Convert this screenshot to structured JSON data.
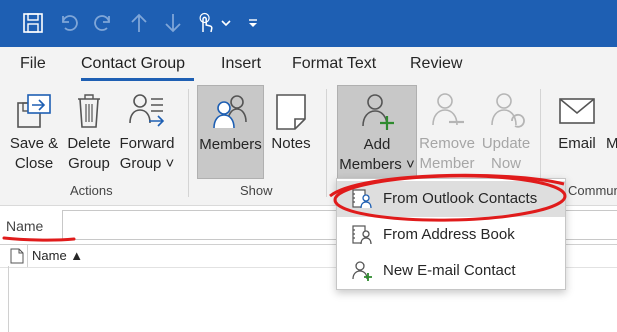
{
  "quick_access": {
    "icons": [
      "save-icon",
      "undo-icon",
      "redo-icon",
      "up-arrow-icon",
      "down-arrow-icon",
      "touch-mode-icon",
      "chevron-down-icon",
      "customize-qat-icon"
    ]
  },
  "tabs": [
    {
      "label": "File",
      "active": false
    },
    {
      "label": "Contact Group",
      "active": true
    },
    {
      "label": "Insert",
      "active": false
    },
    {
      "label": "Format Text",
      "active": false
    },
    {
      "label": "Review",
      "active": false
    }
  ],
  "ribbon": {
    "actions": {
      "group_label": "Actions",
      "save_close": {
        "line1": "Save &",
        "line2": "Close"
      },
      "delete_group": {
        "line1": "Delete",
        "line2": "Group"
      },
      "forward_group": {
        "line1": "Forward",
        "line2": "Group ˅"
      }
    },
    "show": {
      "group_label": "Show",
      "members": {
        "label": "Members"
      },
      "notes": {
        "label": "Notes"
      }
    },
    "members_group": {
      "add_members": {
        "line1": "Add",
        "line2": "Members ˅"
      },
      "remove_member": {
        "line1": "Remove",
        "line2": "Member"
      },
      "update_now": {
        "line1": "Update",
        "line2": "Now"
      }
    },
    "communicate": {
      "group_label": "Commun",
      "email": {
        "label": "Email"
      },
      "meeting_partial": {
        "label": "M"
      }
    }
  },
  "name_field": {
    "label": "Name",
    "value": ""
  },
  "list": {
    "column_header": "Name ▲"
  },
  "add_members_menu": [
    {
      "label": "From Outlook Contacts",
      "icon": "outlook-contacts-icon",
      "highlighted": true
    },
    {
      "label": "From Address Book",
      "icon": "address-book-icon",
      "highlighted": false
    },
    {
      "label": "New E-mail Contact",
      "icon": "new-contact-icon",
      "highlighted": false
    }
  ],
  "colors": {
    "titlebar": "#1e5fb3",
    "ribbon_bg": "#f3f3f3",
    "accent_green": "#2e8b2e",
    "annotation_red": "#e01b1b"
  }
}
